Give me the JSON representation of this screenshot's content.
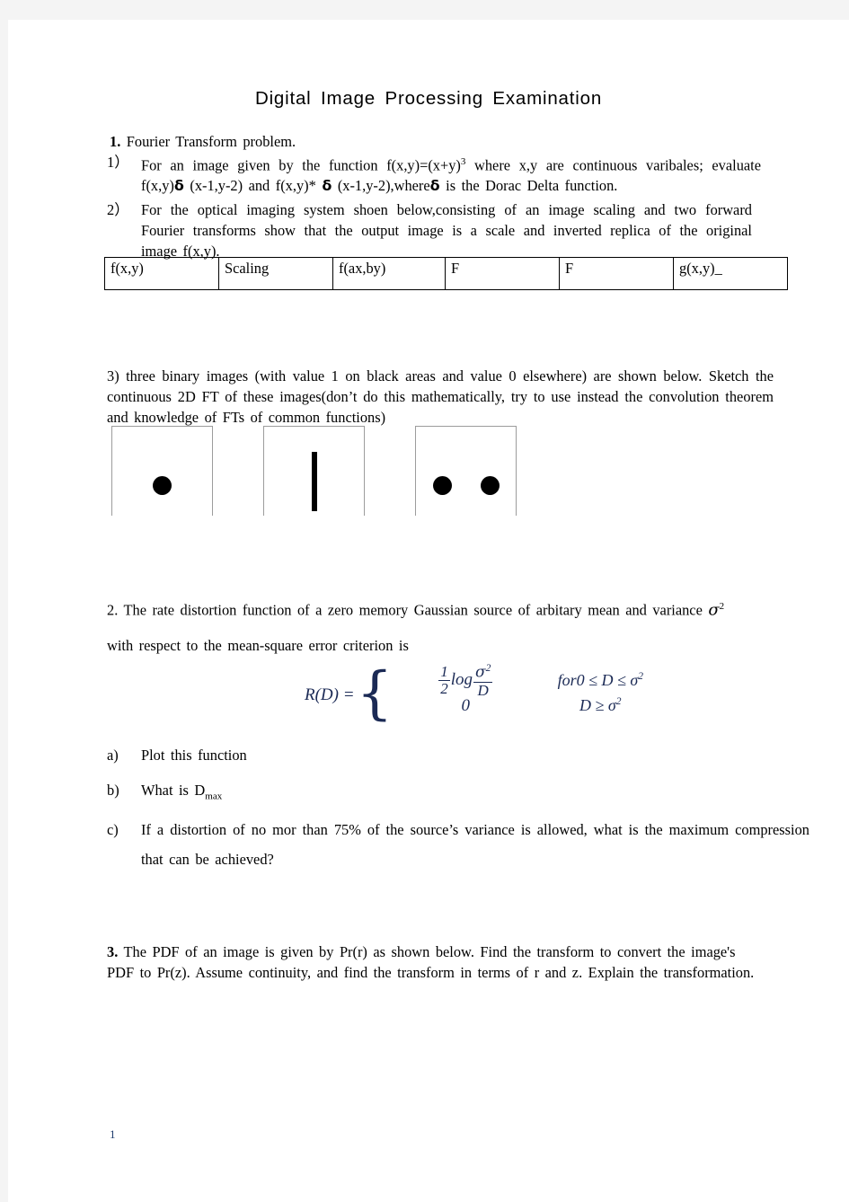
{
  "document": {
    "title": "Digital Image Processing Examination",
    "page_number": "1"
  },
  "q1": {
    "number": "1.",
    "heading": "Fourier Transform problem.",
    "part1": {
      "mark": "1）",
      "line1_a": "For an image given by the function f(x,y)=(x+y)",
      "line1_sup": "3",
      "line1_b": "where x,y are continuous varibales; evaluate",
      "line2_a": "f(x,y)",
      "line2_delta1": "δ",
      "line2_b": "(x-1,y-2) and f(x,y)*",
      "line2_delta2": "δ",
      "line2_c": "(x-1,y-2),where",
      "line2_delta3": "δ",
      "line2_d": "is the Dorac Delta function."
    },
    "part2": {
      "mark": "2）",
      "text": "For the optical imaging system shoen below,consisting of an image scaling and two forward Fourier transforms show that the output image is a scale and inverted replica of the original image f(x,y)."
    },
    "flow_table": {
      "cells": [
        "f(x,y)",
        "Scaling",
        "f(ax,by)",
        "F",
        "F",
        "g(x,y)_"
      ]
    },
    "part3": {
      "text": "3) three binary images (with value 1 on black areas and value 0 elsewhere) are shown below. Sketch the continuous 2D FT of these images(don’t do this mathematically, try to use instead the convolution theorem and knowledge of FTs of common functions)"
    },
    "figures": [
      {
        "name": "single-dot",
        "shapes": [
          {
            "type": "dot"
          }
        ]
      },
      {
        "name": "vertical-bar",
        "shapes": [
          {
            "type": "bar"
          }
        ]
      },
      {
        "name": "two-dots",
        "shapes": [
          {
            "type": "dot"
          },
          {
            "type": "dot"
          }
        ]
      }
    ]
  },
  "q2": {
    "line1_a": "2. The rate distortion function of a zero memory Gaussian source of arbitary mean and variance",
    "line1_sigma": "σ",
    "line1_sup": "2",
    "line2": "with respect to the mean-square error criterion is",
    "formula": {
      "lhs": "R(D) =",
      "case1_expr_frac_num": "1",
      "case1_expr_frac_den": "2",
      "case1_expr_log": "log",
      "case1_expr_arg_num": "σ",
      "case1_expr_arg_num_sup": "2",
      "case1_expr_arg_den": "D",
      "case1_cond_for": "for",
      "case1_cond_rest": "0 ≤ D ≤ σ",
      "case1_cond_sup": "2",
      "case2_expr": "0",
      "case2_cond": "D ≥ σ",
      "case2_cond_sup": "2"
    },
    "items": [
      {
        "mark": "a)",
        "text": "Plot this function"
      },
      {
        "mark": "b)",
        "text_a": "What is D",
        "text_sub": "max"
      },
      {
        "mark": "c)",
        "text": "If a distortion of no mor than 75% of the source’s variance is allowed, what is the maximum compression that can be achieved?"
      }
    ]
  },
  "q3": {
    "number": "3.",
    "text": "The PDF of an image is given by Pr(r) as shown below. Find the transform to convert the image's PDF to Pr(z). Assume continuity, and find the transform in terms of r and z. Explain the transformation."
  }
}
